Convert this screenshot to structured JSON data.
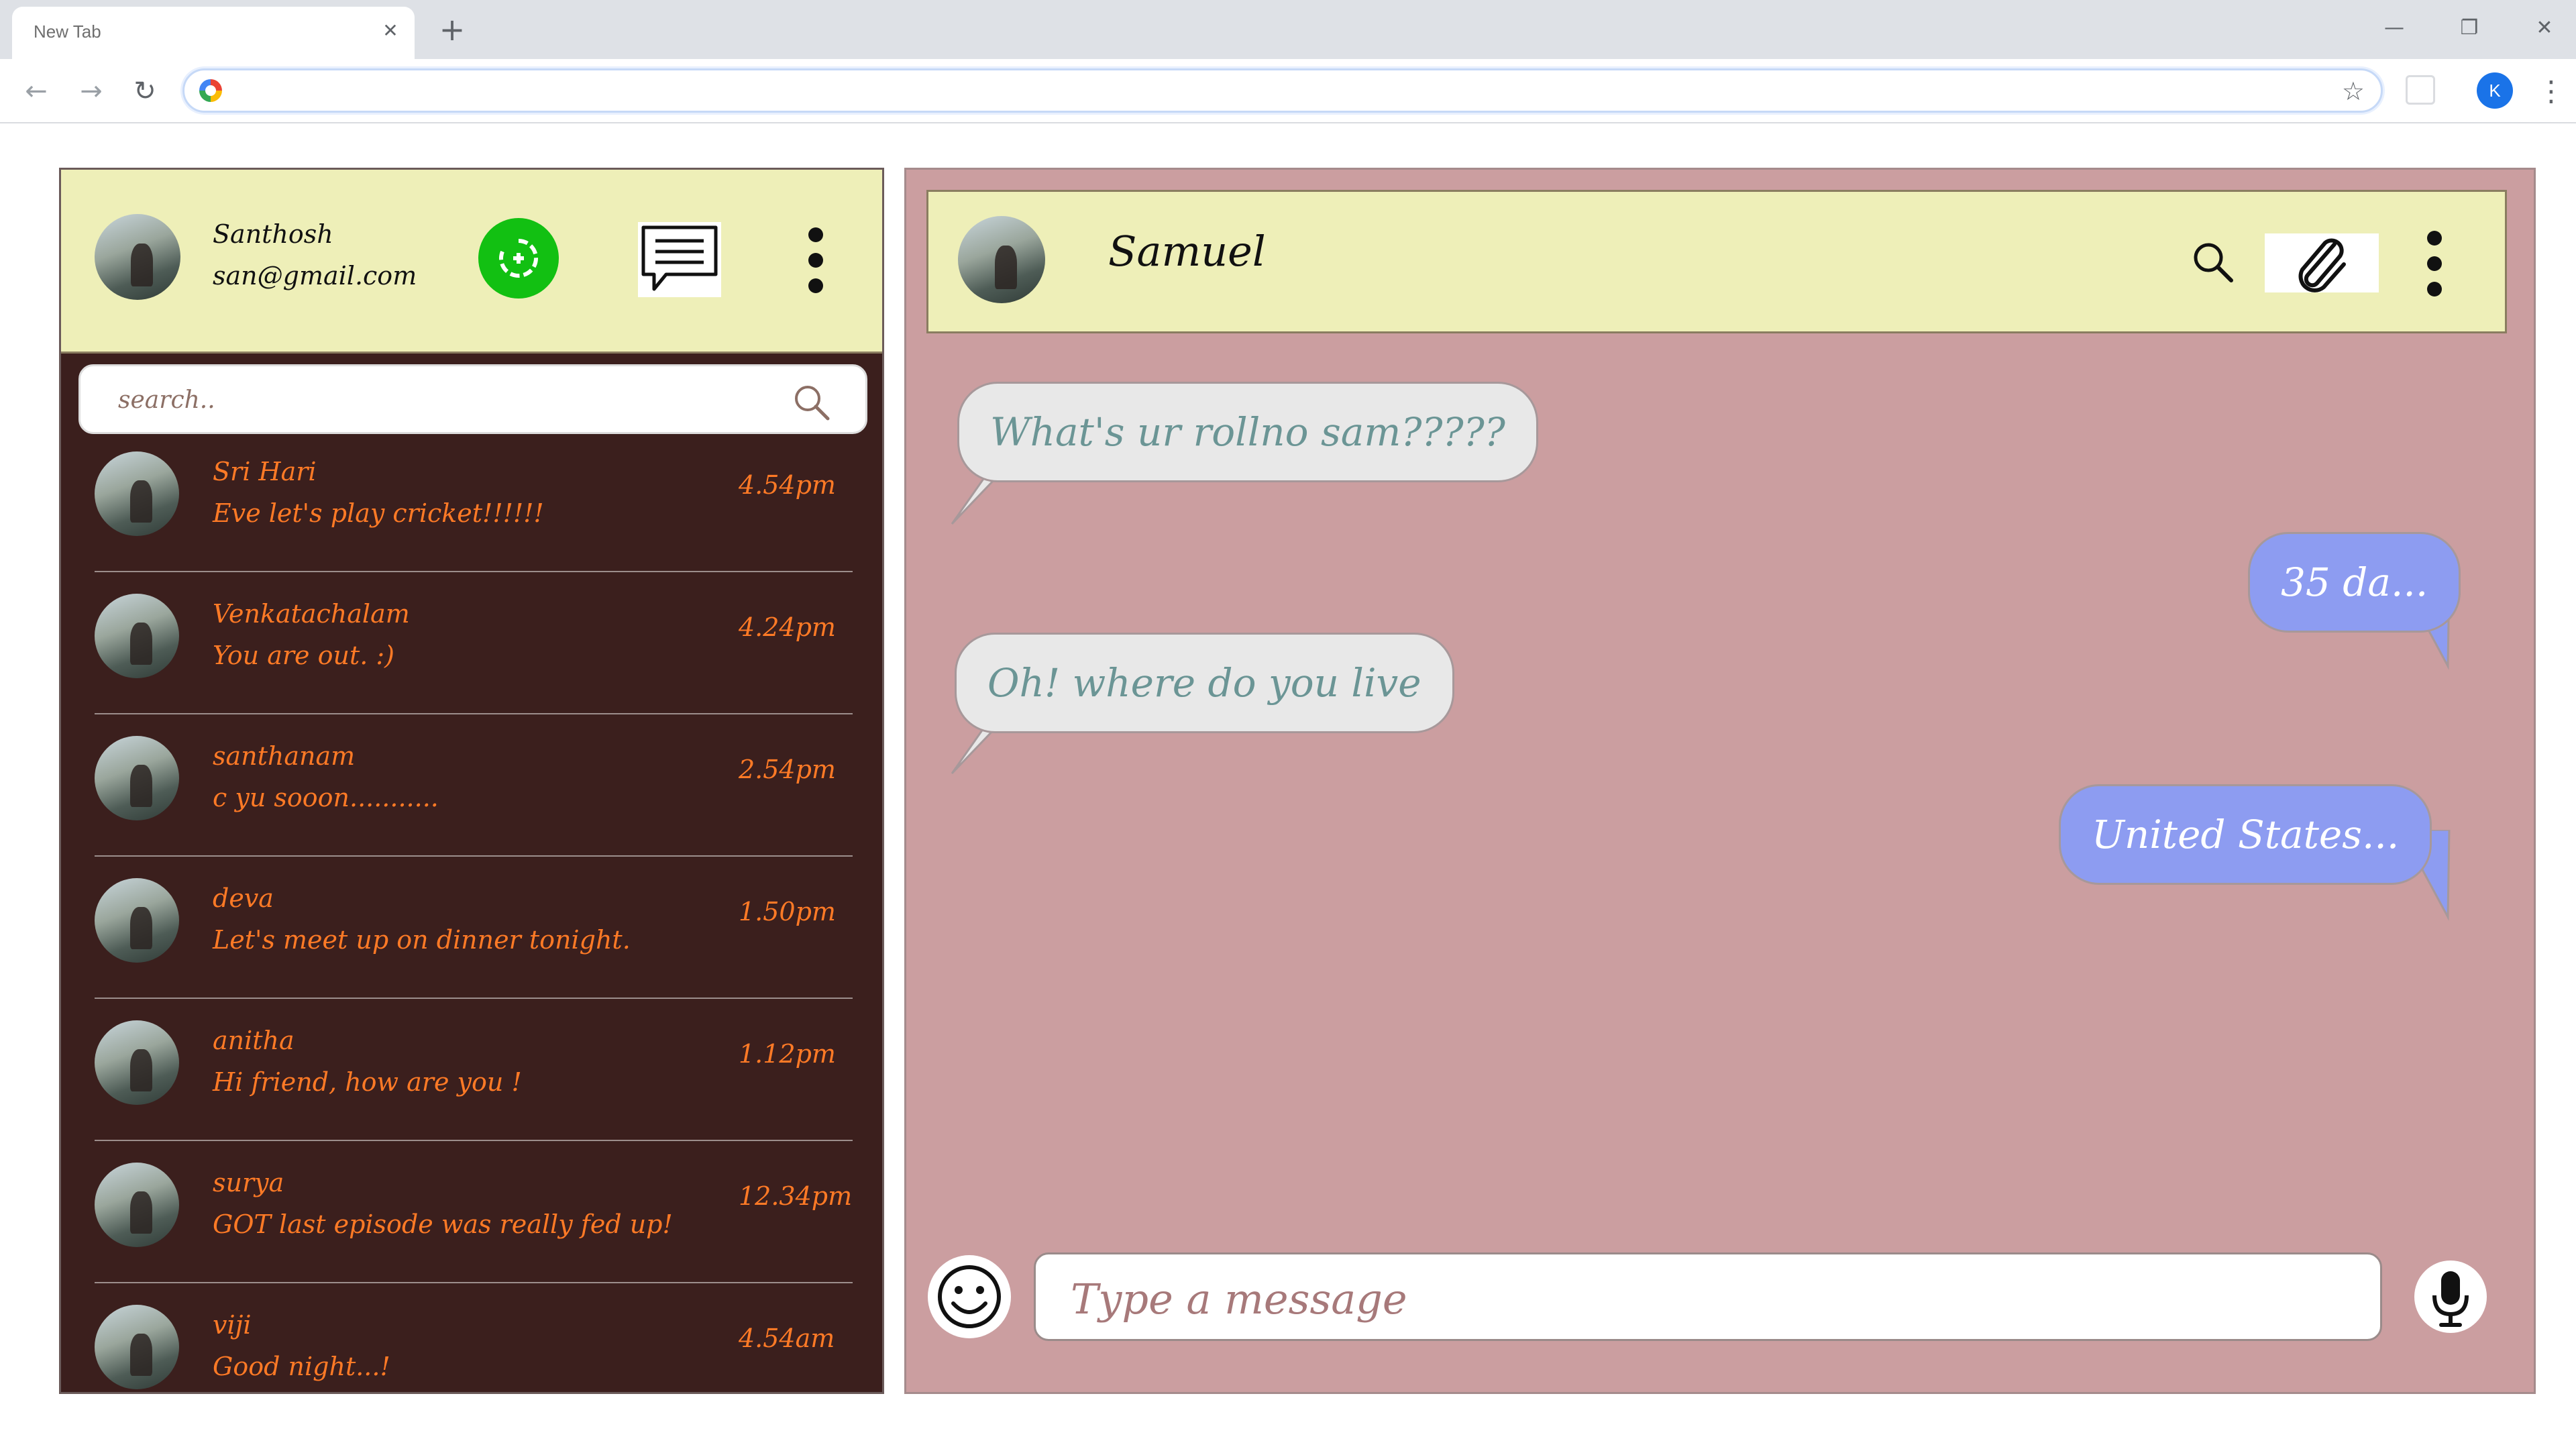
{
  "browser": {
    "tab_title": "New Tab",
    "close_tab": "✕",
    "new_tab": "+",
    "profile_initial": "K"
  },
  "user": {
    "name": "Santhosh",
    "email": "san@gmail.com"
  },
  "search": {
    "placeholder": "search.."
  },
  "contacts": [
    {
      "name": "Sri Hari",
      "message": "Eve let's play cricket!!!!!!",
      "time": "4.54pm"
    },
    {
      "name": "Venkatachalam",
      "message": "You are out. :)",
      "time": "4.24pm"
    },
    {
      "name": "santhanam",
      "message": "c yu sooon...........",
      "time": "2.54pm"
    },
    {
      "name": "deva",
      "message": "Let's meet up on dinner tonight.",
      "time": "1.50pm"
    },
    {
      "name": "anitha",
      "message": "Hi friend, how are you !",
      "time": "1.12pm"
    },
    {
      "name": "surya",
      "message": "GOT last episode was really fed up!",
      "time": "12.34pm"
    },
    {
      "name": "viji",
      "message": "Good night...!",
      "time": "4.54am"
    }
  ],
  "chat": {
    "partner_name": "Samuel",
    "messages": [
      {
        "direction": "incoming",
        "text": "What's ur rollno sam?????"
      },
      {
        "direction": "outgoing",
        "text": "35 da..."
      },
      {
        "direction": "incoming",
        "text": "Oh! where do you live"
      },
      {
        "direction": "outgoing",
        "text": "United States..."
      }
    ],
    "input_placeholder": "Type a message"
  },
  "colors": {
    "header_bg": "#eeefb8",
    "sidebar_bg": "#3b1f1d",
    "contact_text": "#ff7a26",
    "chat_bg": "#cb9ea0",
    "incoming_bubble": "#e8e8e8",
    "outgoing_bubble": "#8d9cf1",
    "status_green": "#12c012"
  },
  "icons": {
    "status": "status-refresh-icon",
    "new_chat": "chat-message-icon",
    "menu": "more-vertical-icon",
    "search": "search-icon",
    "attach": "paperclip-icon",
    "emoji": "smiley-icon",
    "mic": "microphone-icon"
  }
}
